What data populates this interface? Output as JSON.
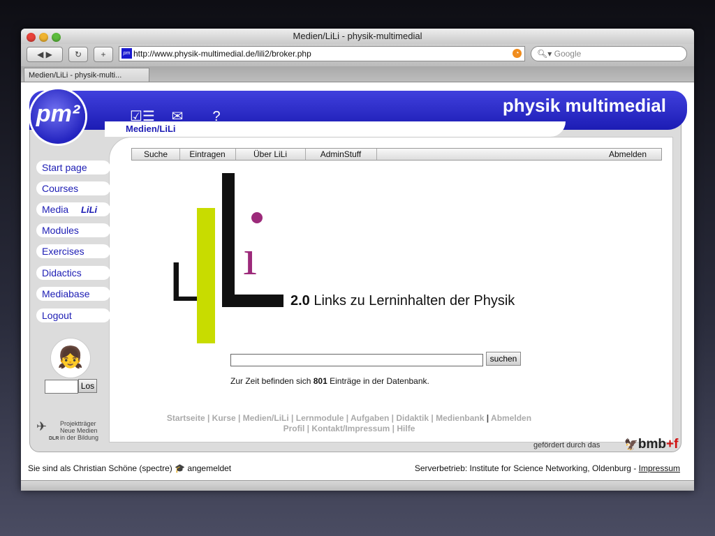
{
  "window": {
    "title": "Medien/LiLi - physik-multimedial"
  },
  "toolbar": {
    "url": "http://www.physik-multimedial.de/lili2/broker.php",
    "search_placeholder": "Google"
  },
  "tab": {
    "label": "Medien/LiLi - physik-multi..."
  },
  "header": {
    "title": "physik multimedial",
    "logo": "pm²",
    "breadcrumb": "Medien/LiLi"
  },
  "menu": {
    "items": [
      "Suche",
      "Eintragen",
      "Über LiLi",
      "AdminStuff"
    ],
    "logout": "Abmelden"
  },
  "sidebar": {
    "items": [
      "Start page",
      "Courses",
      "Media",
      "Modules",
      "Exercises",
      "Didactics",
      "Mediabase",
      "Logout"
    ],
    "media_badge": "LiLi",
    "go_button": "Los"
  },
  "dlr": {
    "line1": "Projektträger",
    "line2": "Neue Medien",
    "line3": "in der Bildung",
    "short": "DLR"
  },
  "main": {
    "tagline_version": "2.0",
    "tagline_text": " Links zu Lerninhalten der Physik",
    "search_button": "suchen",
    "count_prefix": "Zur Zeit befinden sich ",
    "count_value": "801",
    "count_suffix": " Einträge in der Datenbank."
  },
  "footer_nav": {
    "line1": [
      "Startseite",
      "Kurse",
      "Medien/LiLi",
      "Lernmodule",
      "Aufgaben",
      "Didaktik",
      "Medienbank",
      "Abmelden"
    ],
    "line2": [
      "Profil",
      "Kontakt/Impressum",
      "Hilfe"
    ]
  },
  "sponsor": {
    "text": "gefördert durch das",
    "brand_a": "bmb",
    "brand_plus": "+",
    "brand_b": "f"
  },
  "bottom": {
    "user": "Sie sind als Christian Schöne (spectre)",
    "status": "angemeldet",
    "server": "Serverbetrieb: Institute for Science Networking, Oldenburg -",
    "impressum": "Impressum"
  },
  "colors": {
    "brand": "#1c1cb4",
    "lime": "#c8dc00",
    "purple": "#9c2a7a"
  }
}
